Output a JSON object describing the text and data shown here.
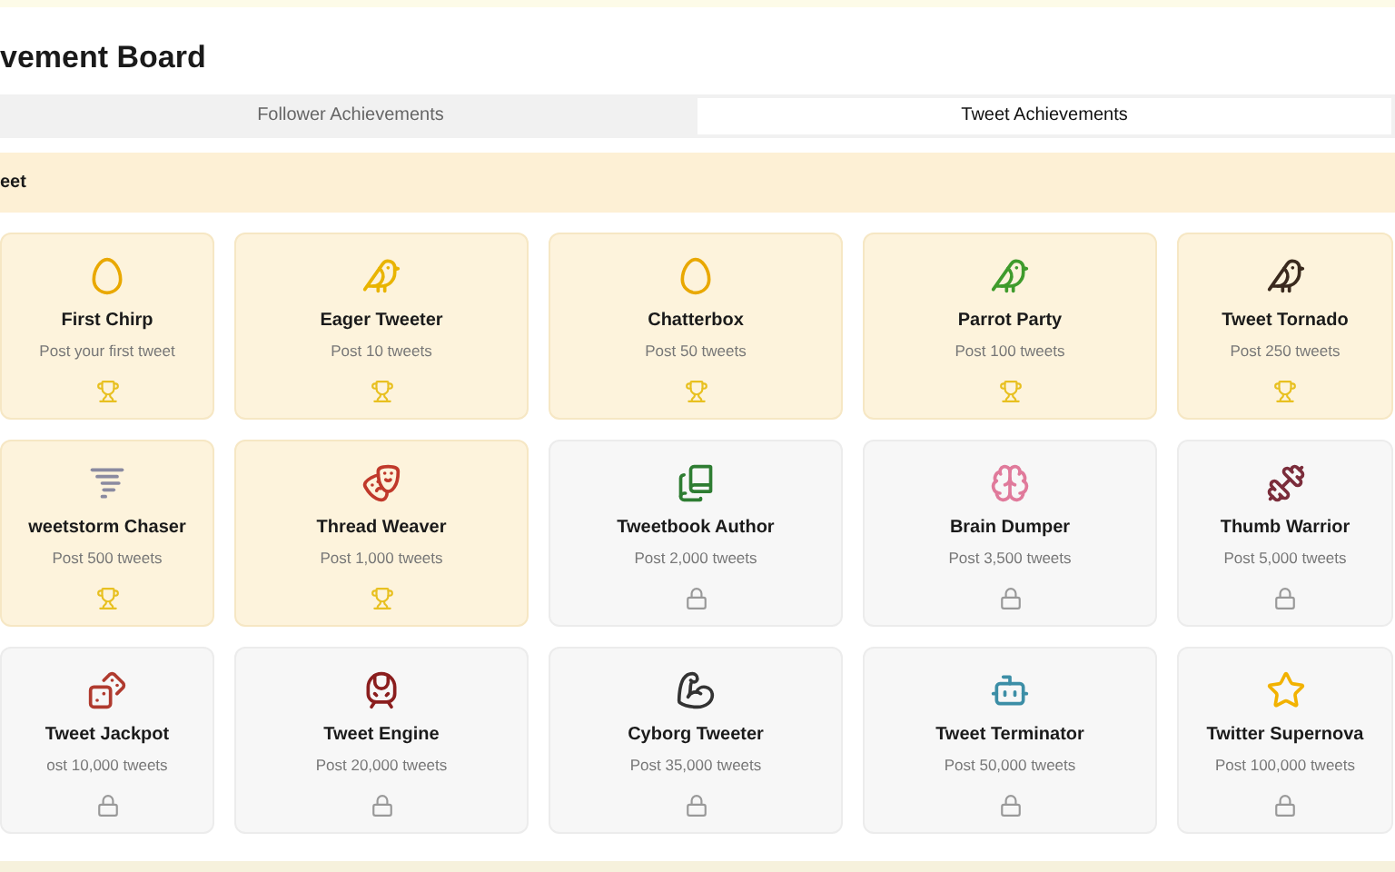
{
  "title": "vement Board",
  "tabs": [
    {
      "label": "Follower Achievements",
      "selected": false
    },
    {
      "label": "Tweet Achievements",
      "selected": true
    }
  ],
  "section": {
    "title": "eet"
  },
  "achievements": [
    {
      "name": "First Chirp",
      "goal": "Post your first tweet",
      "unlocked": true
    },
    {
      "name": "Eager Tweeter",
      "goal": "Post 10 tweets",
      "unlocked": true
    },
    {
      "name": "Chatterbox",
      "goal": "Post 50 tweets",
      "unlocked": true
    },
    {
      "name": "Parrot Party",
      "goal": "Post 100 tweets",
      "unlocked": true
    },
    {
      "name": "Tweet Tornado",
      "goal": "Post 250 tweets",
      "unlocked": true
    },
    {
      "name": "weetstorm Chaser",
      "goal": "Post 500 tweets",
      "unlocked": true
    },
    {
      "name": "Thread Weaver",
      "goal": "Post 1,000 tweets",
      "unlocked": true
    },
    {
      "name": "Tweetbook Author",
      "goal": "Post 2,000 tweets",
      "unlocked": false
    },
    {
      "name": "Brain Dumper",
      "goal": "Post 3,500 tweets",
      "unlocked": false
    },
    {
      "name": "Thumb Warrior",
      "goal": "Post 5,000 tweets",
      "unlocked": false
    },
    {
      "name": "Tweet Jackpot",
      "goal": "ost 10,000 tweets",
      "unlocked": false
    },
    {
      "name": "Tweet Engine",
      "goal": "Post 20,000 tweets",
      "unlocked": false
    },
    {
      "name": "Cyborg Tweeter",
      "goal": "Post 35,000 tweets",
      "unlocked": false
    },
    {
      "name": "Tweet Terminator",
      "goal": "Post 50,000 tweets",
      "unlocked": false
    },
    {
      "name": "Twitter Supernova",
      "goal": "Post 100,000 tweets",
      "unlocked": false
    }
  ]
}
